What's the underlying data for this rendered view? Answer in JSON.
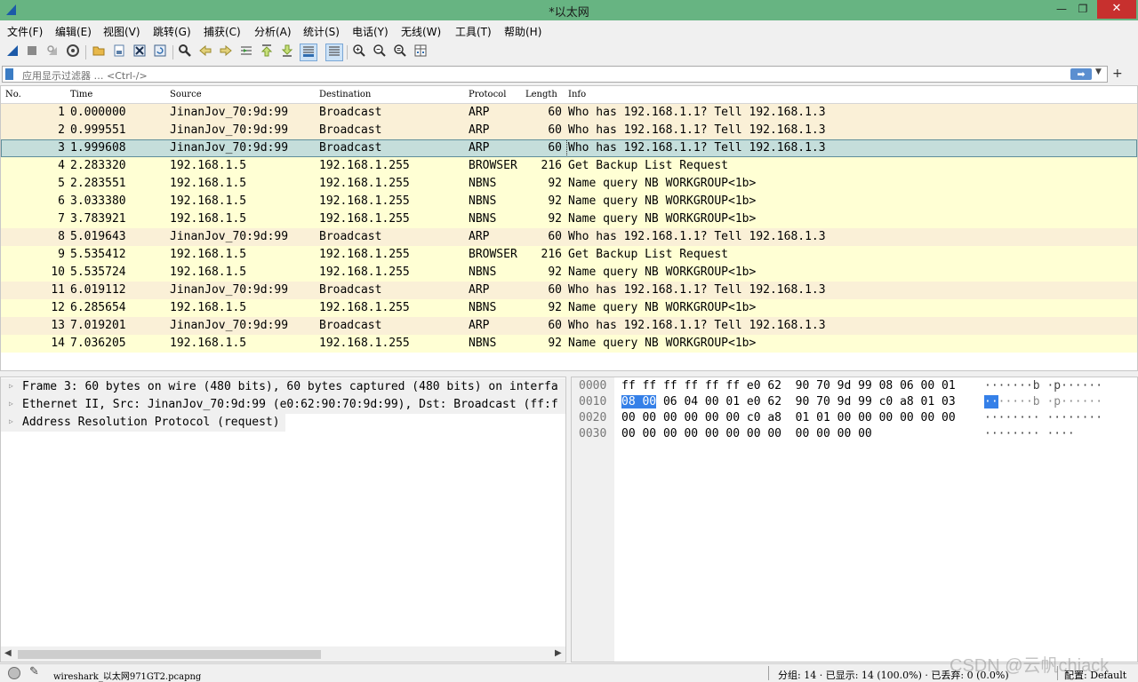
{
  "window": {
    "title": "*以太网",
    "buttons": {
      "minimize": "—",
      "maximize": "❐",
      "close": "✕"
    }
  },
  "menu": [
    "文件(F)",
    "编辑(E)",
    "视图(V)",
    "跳转(G)",
    "捕获(C)",
    "分析(A)",
    "统计(S)",
    "电话(Y)",
    "无线(W)",
    "工具(T)",
    "帮助(H)"
  ],
  "toolbar": {
    "icons": [
      "shark-fin-start-icon",
      "stop-capture-icon",
      "restart-capture-icon",
      "capture-options-icon",
      "open-file-icon",
      "save-file-icon",
      "close-file-icon",
      "reload-file-icon",
      "find-packet-icon",
      "go-back-icon",
      "go-forward-icon",
      "go-to-packet-icon",
      "go-first-icon",
      "go-last-icon",
      "autoscroll-icon",
      "colorize-icon",
      "zoom-in-icon",
      "zoom-out-icon",
      "zoom-normal-icon",
      "resize-columns-icon"
    ]
  },
  "filter": {
    "placeholder": "应用显示过滤器 … <Ctrl-/>",
    "apply_glyph": "➡",
    "dropdown_glyph": "▼",
    "add_glyph": "+"
  },
  "packet_list": {
    "columns": [
      "No.",
      "Time",
      "Source",
      "Destination",
      "Protocol",
      "Length",
      "Info"
    ],
    "selected_row": 3,
    "rows": [
      {
        "no": "1",
        "time": "0.000000",
        "src": "JinanJov_70:9d:99",
        "dst": "Broadcast",
        "proto": "ARP",
        "len": "60",
        "info": "Who has 192.168.1.1? Tell 192.168.1.3"
      },
      {
        "no": "2",
        "time": "0.999551",
        "src": "JinanJov_70:9d:99",
        "dst": "Broadcast",
        "proto": "ARP",
        "len": "60",
        "info": "Who has 192.168.1.1? Tell 192.168.1.3"
      },
      {
        "no": "3",
        "time": "1.999608",
        "src": "JinanJov_70:9d:99",
        "dst": "Broadcast",
        "proto": "ARP",
        "len": "60",
        "info": "Who has 192.168.1.1? Tell 192.168.1.3"
      },
      {
        "no": "4",
        "time": "2.283320",
        "src": "192.168.1.5",
        "dst": "192.168.1.255",
        "proto": "BROWSER",
        "len": "216",
        "info": "Get Backup List Request"
      },
      {
        "no": "5",
        "time": "2.283551",
        "src": "192.168.1.5",
        "dst": "192.168.1.255",
        "proto": "NBNS",
        "len": "92",
        "info": "Name query NB WORKGROUP<1b>"
      },
      {
        "no": "6",
        "time": "3.033380",
        "src": "192.168.1.5",
        "dst": "192.168.1.255",
        "proto": "NBNS",
        "len": "92",
        "info": "Name query NB WORKGROUP<1b>"
      },
      {
        "no": "7",
        "time": "3.783921",
        "src": "192.168.1.5",
        "dst": "192.168.1.255",
        "proto": "NBNS",
        "len": "92",
        "info": "Name query NB WORKGROUP<1b>"
      },
      {
        "no": "8",
        "time": "5.019643",
        "src": "JinanJov_70:9d:99",
        "dst": "Broadcast",
        "proto": "ARP",
        "len": "60",
        "info": "Who has 192.168.1.1? Tell 192.168.1.3"
      },
      {
        "no": "9",
        "time": "5.535412",
        "src": "192.168.1.5",
        "dst": "192.168.1.255",
        "proto": "BROWSER",
        "len": "216",
        "info": "Get Backup List Request"
      },
      {
        "no": "10",
        "time": "5.535724",
        "src": "192.168.1.5",
        "dst": "192.168.1.255",
        "proto": "NBNS",
        "len": "92",
        "info": "Name query NB WORKGROUP<1b>"
      },
      {
        "no": "11",
        "time": "6.019112",
        "src": "JinanJov_70:9d:99",
        "dst": "Broadcast",
        "proto": "ARP",
        "len": "60",
        "info": "Who has 192.168.1.1? Tell 192.168.1.3"
      },
      {
        "no": "12",
        "time": "6.285654",
        "src": "192.168.1.5",
        "dst": "192.168.1.255",
        "proto": "NBNS",
        "len": "92",
        "info": "Name query NB WORKGROUP<1b>"
      },
      {
        "no": "13",
        "time": "7.019201",
        "src": "JinanJov_70:9d:99",
        "dst": "Broadcast",
        "proto": "ARP",
        "len": "60",
        "info": "Who has 192.168.1.1? Tell 192.168.1.3"
      },
      {
        "no": "14",
        "time": "7.036205",
        "src": "192.168.1.5",
        "dst": "192.168.1.255",
        "proto": "NBNS",
        "len": "92",
        "info": "Name query NB WORKGROUP<1b>"
      }
    ]
  },
  "details": [
    "Frame 3: 60 bytes on wire (480 bits), 60 bytes captured (480 bits) on interfa",
    "Ethernet II, Src: JinanJov_70:9d:99 (e0:62:90:70:9d:99), Dst: Broadcast (ff:f",
    "Address Resolution Protocol (request)"
  ],
  "bytes": {
    "offsets": [
      "0000",
      "0010",
      "0020",
      "0030"
    ],
    "hex_line0": "ff ff ff ff ff ff e0 62  90 70 9d 99 08 06 00 01",
    "hex_line1_highlight": "08 00",
    "hex_line1_rest": " 06 04 00 01 e0 62  90 70 9d 99 c0 a8 01 03",
    "hex_line2": "00 00 00 00 00 00 c0 a8  01 01 00 00 00 00 00 00",
    "hex_line3": "00 00 00 00 00 00 00 00  00 00 00 00",
    "ascii_line0": "·······b ·p······",
    "ascii_line1_highlight": "··",
    "ascii_line1_rest": "·····b ·p······",
    "ascii_line2": "········ ········",
    "ascii_line3": "········ ····"
  },
  "status": {
    "file": "wireshark_以太网971GT2.pcapng",
    "stats": "分组: 14 · 已显示: 14 (100.0%) · 已丢弃: 0 (0.0%)",
    "profile": "配置: Default"
  },
  "watermark": "CSDN @云帆chiack",
  "colors": {
    "titlebar": "#67b482",
    "arp_row": "#faf0d7",
    "udp_row": "#ffffd4",
    "selected_row": "#c5dedb",
    "hex_highlight": "#3580e8",
    "close_button": "#c7302e"
  }
}
